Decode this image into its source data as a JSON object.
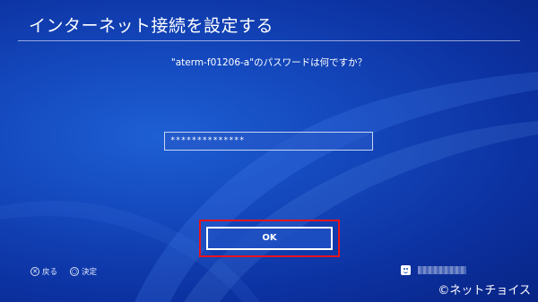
{
  "screen": {
    "title": "インターネット接続を設定する",
    "prompt": "\"aterm-f01206-a\"のパスワードは何ですか？"
  },
  "password_field": {
    "masked_value": "**************"
  },
  "ok_button": {
    "label": "OK"
  },
  "controls": {
    "back_label": "戻る",
    "back_icon": "cross-button-icon",
    "confirm_label": "決定",
    "confirm_icon": "circle-button-icon"
  },
  "user": {
    "avatar_icon": "smiley-avatar-icon"
  },
  "watermark": "©ネットチョイス",
  "colors": {
    "background": "#1448bd",
    "highlight": "#e8141c",
    "text": "#ffffff"
  }
}
